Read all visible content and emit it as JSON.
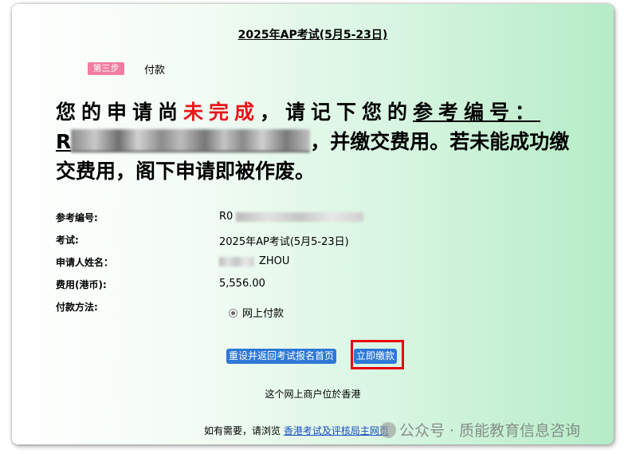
{
  "exam_title": "2025年AP考试(5月5-23日)",
  "step": {
    "badge": "第三步",
    "label": "付款"
  },
  "headline": {
    "part1": "您的申请尚",
    "part2": "未完成",
    "part3": "，请记下您的",
    "part4": "参考编号：",
    "ref_start": "R",
    "part5": "，并缴交费用。若未能成功缴交费用，阁下申请即被作废。"
  },
  "details": {
    "ref_label": "参考编号:",
    "ref_value": "R0",
    "exam_label": "考试:",
    "exam_value": "2025年AP考试(5月5-23日)",
    "name_label": "申请人姓名：",
    "name_value": "ZHOU",
    "fee_label": "费用(港币):",
    "fee_value": "5,556.00",
    "payment_label": "付款方法:",
    "payment_option": "网上付款"
  },
  "buttons": {
    "reset": "重设并返回考试报名首页",
    "pay": "立即缴款"
  },
  "merchant_note": "这个网上商户位於香港",
  "footer": {
    "prefix": "如有需要，请浏览 ",
    "link": "香港考试及评核局主网页"
  },
  "watermark": "公众号 · 质能教育信息咨询"
}
